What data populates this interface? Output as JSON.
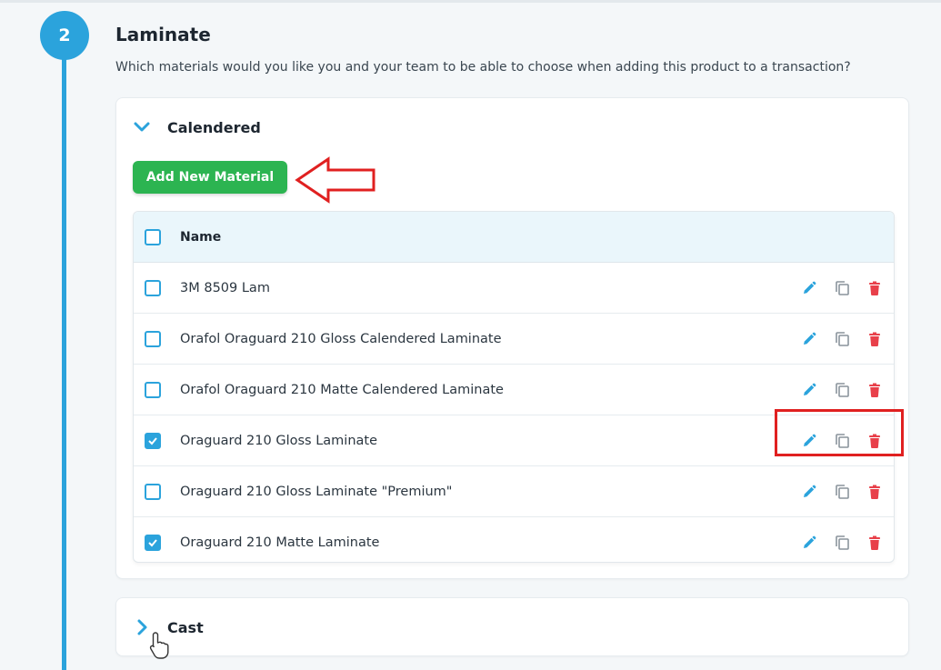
{
  "step": {
    "number": "2",
    "title": "Laminate",
    "description": "Which materials would you like you and your team to be able to choose when adding this product to a transaction?"
  },
  "groups": {
    "calendered": {
      "title": "Calendered",
      "expanded": true,
      "add_button_label": "Add New Material"
    },
    "cast": {
      "title": "Cast",
      "expanded": false
    }
  },
  "table": {
    "header": "Name",
    "rows": [
      {
        "name": "3M 8509 Lam",
        "checked": false
      },
      {
        "name": "Orafol Oraguard 210 Gloss Calendered Laminate",
        "checked": false
      },
      {
        "name": "Orafol Oraguard 210 Matte Calendered Laminate",
        "checked": false
      },
      {
        "name": "Oraguard 210 Gloss Laminate",
        "checked": true
      },
      {
        "name": "Oraguard 210 Gloss Laminate \"Premium\"",
        "checked": false
      },
      {
        "name": "Oraguard 210 Matte Laminate",
        "checked": true
      }
    ]
  },
  "icons": {
    "edit": "pencil-icon",
    "duplicate": "copy-icon",
    "delete": "trash-icon"
  },
  "colors": {
    "accent": "#2ba3dc",
    "add_button": "#2cb451",
    "delete": "#e8404a",
    "annotation": "#e02020"
  }
}
